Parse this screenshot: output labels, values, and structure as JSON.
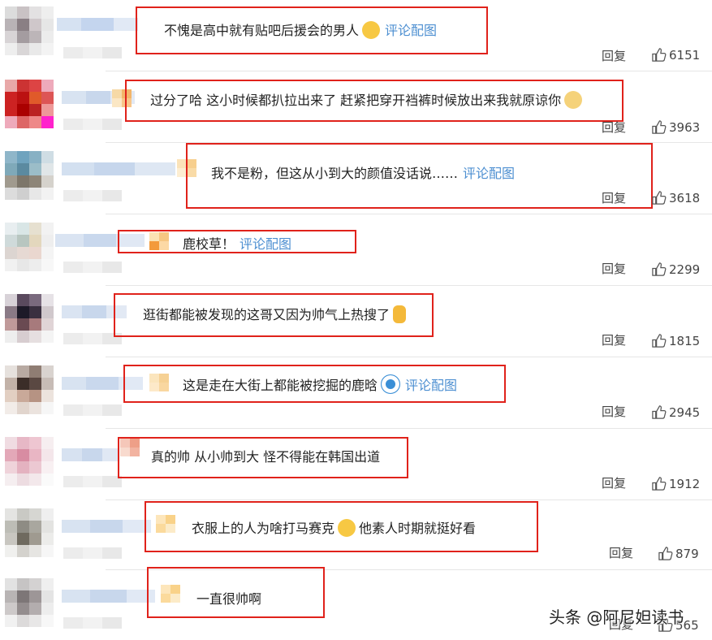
{
  "comments": [
    {
      "text": "不愧是高中就有贴吧后援会的男人",
      "link": "评论配图",
      "reply": "回复",
      "likes": "6151",
      "emoji": "smiling-face-emoji"
    },
    {
      "text": "过分了哈 这小时候都扒拉出来了 赶紧把穿开裆裤时候放出来我就原谅你",
      "link": "",
      "reply": "回复",
      "likes": "3963",
      "emoji": "cat-face-emoji"
    },
    {
      "text": "我不是粉，但这从小到大的颜值没话说……",
      "link": "评论配图",
      "reply": "回复",
      "likes": "3618",
      "emoji": ""
    },
    {
      "text": "鹿校草！",
      "link": "评论配图",
      "reply": "回复",
      "likes": "2299",
      "emoji": ""
    },
    {
      "text": "逛街都能被发现的这哥又因为帅气上热搜了",
      "link": "",
      "reply": "回复",
      "likes": "1815",
      "emoji": "figure-emoji"
    },
    {
      "text": "这是走在大街上都能被挖掘的鹿晗",
      "link": "评论配图",
      "reply": "回复",
      "likes": "2945",
      "emoji": "doraemon-emoji"
    },
    {
      "text": "真的帅 从小帅到大 怪不得能在韩国出道",
      "link": "",
      "reply": "回复",
      "likes": "1912",
      "emoji": ""
    },
    {
      "text_a": "衣服上的人为啥打马赛克",
      "text_b": "他素人时期就挺好看",
      "reply": "回复",
      "likes": "879",
      "emoji": "tears-of-joy-emoji"
    },
    {
      "text": "一直很帅啊",
      "link": "",
      "reply": "回复",
      "likes": "565",
      "emoji": ""
    }
  ],
  "watermark": "头条 @阿尼妲读书",
  "colors": {
    "highlight_border": "#e0221b",
    "link": "#4d8fd1",
    "divider": "#e6e6e6"
  }
}
